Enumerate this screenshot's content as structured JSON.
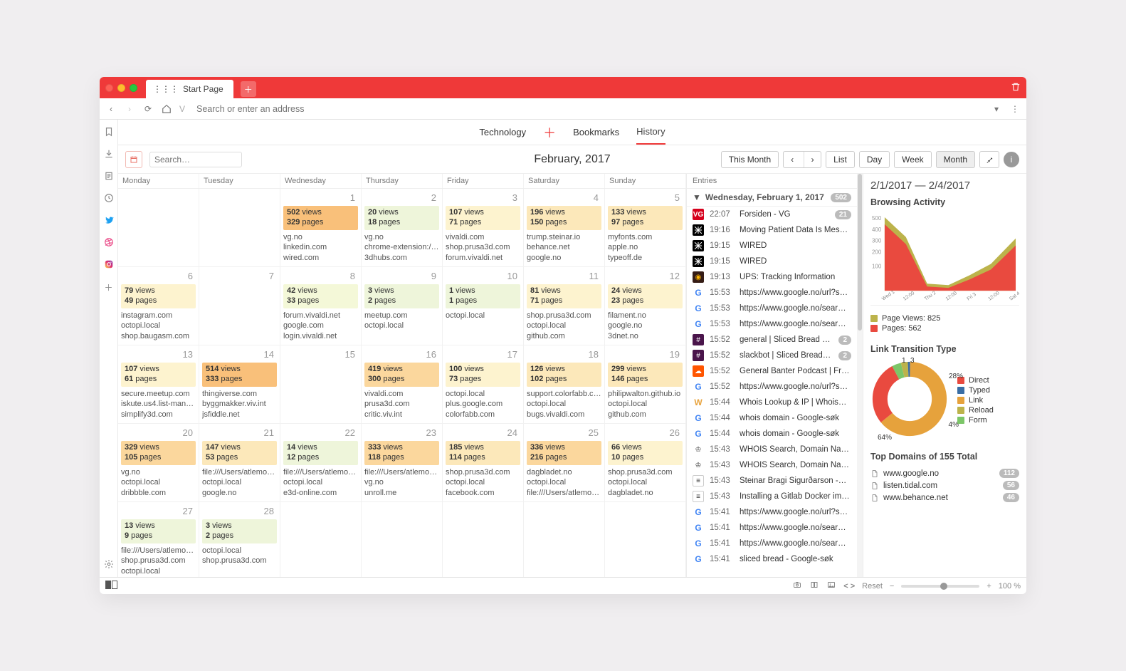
{
  "browser": {
    "tab": "Start Page",
    "address_placeholder": "Search or enter an address"
  },
  "nav": {
    "items": [
      "Technology",
      "Bookmarks",
      "History"
    ],
    "active": 2
  },
  "controls": {
    "search_placeholder": "Search…",
    "title": "February, 2017",
    "this_month": "This Month",
    "views": [
      "List",
      "Day",
      "Week",
      "Month"
    ],
    "active_view": "Month"
  },
  "weekdays": [
    "Monday",
    "Tuesday",
    "Wednesday",
    "Thursday",
    "Friday",
    "Saturday",
    "Sunday"
  ],
  "cells": [
    {
      "n": "",
      "empty": true
    },
    {
      "n": "",
      "empty": true
    },
    {
      "n": "1",
      "views": 502,
      "pages": 329,
      "heat": 5,
      "d": [
        "vg.no",
        "linkedin.com",
        "wired.com"
      ]
    },
    {
      "n": "2",
      "views": 20,
      "pages": 18,
      "heat": 0,
      "d": [
        "vg.no",
        "chrome-extension://…",
        "3dhubs.com"
      ]
    },
    {
      "n": "3",
      "views": 107,
      "pages": 71,
      "heat": 2,
      "d": [
        "vivaldi.com",
        "shop.prusa3d.com",
        "forum.vivaldi.net"
      ]
    },
    {
      "n": "4",
      "views": 196,
      "pages": 150,
      "heat": 3,
      "d": [
        "trump.steinar.io",
        "behance.net",
        "google.no"
      ]
    },
    {
      "n": "5",
      "views": 133,
      "pages": 97,
      "heat": 3,
      "d": [
        "myfonts.com",
        "apple.no",
        "typeoff.de"
      ]
    },
    {
      "n": "6",
      "views": 79,
      "pages": 49,
      "heat": 2,
      "d": [
        "instagram.com",
        "octopi.local",
        "shop.baugasm.com"
      ]
    },
    {
      "n": "7",
      "empty": true
    },
    {
      "n": "8",
      "views": 42,
      "pages": 33,
      "heat": 1,
      "d": [
        "forum.vivaldi.net",
        "google.com",
        "login.vivaldi.net"
      ]
    },
    {
      "n": "9",
      "views": 3,
      "pages": 2,
      "heat": 0,
      "d": [
        "meetup.com",
        "octopi.local"
      ]
    },
    {
      "n": "10",
      "views": 1,
      "pages": 1,
      "heat": 0,
      "d": [
        "octopi.local"
      ]
    },
    {
      "n": "11",
      "views": 81,
      "pages": 71,
      "heat": 2,
      "d": [
        "shop.prusa3d.com",
        "octopi.local",
        "github.com"
      ]
    },
    {
      "n": "12",
      "views": 24,
      "pages": 23,
      "heat": 2,
      "d": [
        "filament.no",
        "google.no",
        "3dnet.no"
      ]
    },
    {
      "n": "13",
      "views": 107,
      "pages": 61,
      "heat": 2,
      "d": [
        "secure.meetup.com",
        "iskute.us4.list-manag…",
        "simplify3d.com"
      ]
    },
    {
      "n": "14",
      "views": 514,
      "pages": 333,
      "heat": 5,
      "d": [
        "thingiverse.com",
        "byggmakker.viv.int",
        "jsfiddle.net"
      ]
    },
    {
      "n": "15",
      "empty": true
    },
    {
      "n": "16",
      "views": 419,
      "pages": 300,
      "heat": 4,
      "d": [
        "vivaldi.com",
        "prusa3d.com",
        "critic.viv.int"
      ]
    },
    {
      "n": "17",
      "views": 100,
      "pages": 73,
      "heat": 2,
      "d": [
        "octopi.local",
        "plus.google.com",
        "colorfabb.com"
      ]
    },
    {
      "n": "18",
      "views": 126,
      "pages": 102,
      "heat": 3,
      "d": [
        "support.colorfabb.co…",
        "octopi.local",
        "bugs.vivaldi.com"
      ]
    },
    {
      "n": "19",
      "views": 299,
      "pages": 146,
      "heat": 3,
      "d": [
        "philipwalton.github.io",
        "octopi.local",
        "github.com"
      ]
    },
    {
      "n": "20",
      "views": 329,
      "pages": 105,
      "heat": 4,
      "d": [
        "vg.no",
        "octopi.local",
        "dribbble.com"
      ]
    },
    {
      "n": "21",
      "views": 147,
      "pages": 53,
      "heat": 3,
      "d": [
        "file:///Users/atlemo/D…",
        "octopi.local",
        "google.no"
      ]
    },
    {
      "n": "22",
      "views": 14,
      "pages": 12,
      "heat": 0,
      "d": [
        "file:///Users/atlemo/D…",
        "octopi.local",
        "e3d-online.com"
      ]
    },
    {
      "n": "23",
      "views": 333,
      "pages": 118,
      "heat": 4,
      "d": [
        "file:///Users/atlemo/D…",
        "vg.no",
        "unroll.me"
      ]
    },
    {
      "n": "24",
      "views": 185,
      "pages": 114,
      "heat": 3,
      "d": [
        "shop.prusa3d.com",
        "octopi.local",
        "facebook.com"
      ]
    },
    {
      "n": "25",
      "views": 336,
      "pages": 216,
      "heat": 4,
      "d": [
        "dagbladet.no",
        "octopi.local",
        "file:///Users/atlemo/D…"
      ]
    },
    {
      "n": "26",
      "views": 66,
      "pages": 10,
      "heat": 2,
      "d": [
        "shop.prusa3d.com",
        "octopi.local",
        "dagbladet.no"
      ]
    },
    {
      "n": "27",
      "views": 13,
      "pages": 9,
      "heat": 0,
      "d": [
        "file:///Users/atlemo/D…",
        "shop.prusa3d.com",
        "octopi.local"
      ]
    },
    {
      "n": "28",
      "views": 3,
      "pages": 2,
      "heat": 0,
      "d": [
        "octopi.local",
        "shop.prusa3d.com"
      ]
    },
    {
      "n": "",
      "empty": true
    },
    {
      "n": "",
      "empty": true
    },
    {
      "n": "",
      "empty": true
    },
    {
      "n": "",
      "empty": true
    },
    {
      "n": "",
      "empty": true
    }
  ],
  "entries": {
    "header": "Entries",
    "day": "Wednesday, February 1, 2017",
    "count": "502",
    "list": [
      {
        "t": "22:07",
        "title": "Forsiden - VG",
        "fav": "vg",
        "badge": "21"
      },
      {
        "t": "19:16",
        "title": "Moving Patient Data Is Mes…",
        "fav": "wired"
      },
      {
        "t": "19:15",
        "title": "WIRED",
        "fav": "wired"
      },
      {
        "t": "19:15",
        "title": "WIRED",
        "fav": "wired"
      },
      {
        "t": "19:13",
        "title": "UPS: Tracking Information",
        "fav": "ups"
      },
      {
        "t": "15:53",
        "title": "https://www.google.no/url?s…",
        "fav": "g"
      },
      {
        "t": "15:53",
        "title": "https://www.google.no/sear…",
        "fav": "g"
      },
      {
        "t": "15:53",
        "title": "https://www.google.no/sear…",
        "fav": "g"
      },
      {
        "t": "15:52",
        "title": "general | Sliced Bread Sla…",
        "fav": "slack",
        "badge": "2"
      },
      {
        "t": "15:52",
        "title": "slackbot | Sliced Bread S…",
        "fav": "slack",
        "badge": "2"
      },
      {
        "t": "15:52",
        "title": "General Banter Podcast | Fr…",
        "fav": "sc"
      },
      {
        "t": "15:52",
        "title": "https://www.google.no/url?s…",
        "fav": "g"
      },
      {
        "t": "15:44",
        "title": "Whois Lookup & IP | Whois…",
        "fav": "w"
      },
      {
        "t": "15:44",
        "title": "whois domain - Google-søk",
        "fav": "g"
      },
      {
        "t": "15:44",
        "title": "whois domain - Google-søk",
        "fav": "g"
      },
      {
        "t": "15:43",
        "title": "WHOIS Search, Domain Na…",
        "fav": "whois"
      },
      {
        "t": "15:43",
        "title": "WHOIS Search, Domain Na…",
        "fav": "whois"
      },
      {
        "t": "15:43",
        "title": "Steinar Bragi Sigurðarson -…",
        "fav": "doc"
      },
      {
        "t": "15:43",
        "title": "Installing a Gitlab Docker im…",
        "fav": "doc"
      },
      {
        "t": "15:41",
        "title": "https://www.google.no/url?s…",
        "fav": "g"
      },
      {
        "t": "15:41",
        "title": "https://www.google.no/sear…",
        "fav": "g"
      },
      {
        "t": "15:41",
        "title": "https://www.google.no/sear…",
        "fav": "g"
      },
      {
        "t": "15:41",
        "title": "sliced bread - Google-søk",
        "fav": "g"
      }
    ]
  },
  "right": {
    "range": "2/1/2017 — 2/4/2017",
    "activity_title": "Browsing Activity",
    "legend_pv": "Page Views: 825",
    "legend_pg": "Pages: 562",
    "donut_title": "Link Transition Type",
    "donut_legend": [
      "Direct",
      "Typed",
      "Link",
      "Reload",
      "Form"
    ],
    "donut_labels": {
      "top1": "1",
      "top3": "3",
      "right": "28%",
      "br": "4%",
      "bottom": "64%"
    },
    "topdomains_title": "Top Domains of 155 Total",
    "topdomains": [
      {
        "d": "www.google.no",
        "c": "112"
      },
      {
        "d": "listen.tidal.com",
        "c": "56"
      },
      {
        "d": "www.behance.net",
        "c": "46"
      }
    ]
  },
  "chart_data": {
    "type": "area",
    "x": [
      "Wed 1",
      "12:00",
      "Thu 2",
      "12:00",
      "Fri 3",
      "12:00",
      "Sat 4"
    ],
    "ylim": [
      0,
      500
    ],
    "yticks": [
      100,
      200,
      300,
      400,
      500
    ],
    "series": [
      {
        "name": "Page Views",
        "color": "#bcb34b",
        "values": [
          500,
          360,
          40,
          30,
          110,
          190,
          370
        ]
      },
      {
        "name": "Pages",
        "color": "#e94a3f",
        "values": [
          450,
          310,
          30,
          20,
          80,
          150,
          320
        ]
      }
    ]
  },
  "status": {
    "reset": "Reset",
    "zoom": "100 %"
  }
}
